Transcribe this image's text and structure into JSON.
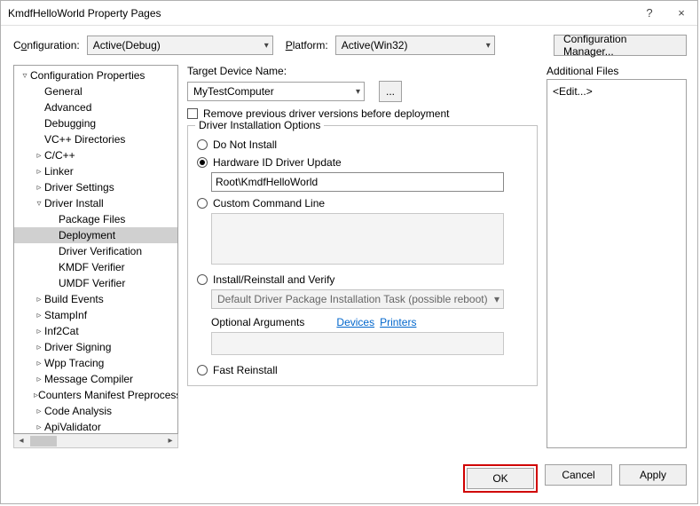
{
  "window": {
    "title": "KmdfHelloWorld Property Pages",
    "help": "?",
    "close": "×"
  },
  "top": {
    "config_label_pre": "C",
    "config_label_u": "o",
    "config_label_post": "nfiguration:",
    "config_value": "Active(Debug)",
    "platform_label_pre": "",
    "platform_label_u": "P",
    "platform_label_post": "latform:",
    "platform_value": "Active(Win32)",
    "config_mgr": "Configuration Manager..."
  },
  "tree": [
    {
      "d": 0,
      "t": "▿",
      "l": "Configuration Properties"
    },
    {
      "d": 1,
      "t": "",
      "l": "General"
    },
    {
      "d": 1,
      "t": "",
      "l": "Advanced"
    },
    {
      "d": 1,
      "t": "",
      "l": "Debugging"
    },
    {
      "d": 1,
      "t": "",
      "l": "VC++ Directories"
    },
    {
      "d": 1,
      "t": "▹",
      "l": "C/C++"
    },
    {
      "d": 1,
      "t": "▹",
      "l": "Linker"
    },
    {
      "d": 1,
      "t": "▹",
      "l": "Driver Settings"
    },
    {
      "d": 1,
      "t": "▿",
      "l": "Driver Install"
    },
    {
      "d": 2,
      "t": "",
      "l": "Package Files"
    },
    {
      "d": 2,
      "t": "",
      "l": "Deployment",
      "sel": true
    },
    {
      "d": 2,
      "t": "",
      "l": "Driver Verification"
    },
    {
      "d": 2,
      "t": "",
      "l": "KMDF Verifier"
    },
    {
      "d": 2,
      "t": "",
      "l": "UMDF Verifier"
    },
    {
      "d": 1,
      "t": "▹",
      "l": "Build Events"
    },
    {
      "d": 1,
      "t": "▹",
      "l": "StampInf"
    },
    {
      "d": 1,
      "t": "▹",
      "l": "Inf2Cat"
    },
    {
      "d": 1,
      "t": "▹",
      "l": "Driver Signing"
    },
    {
      "d": 1,
      "t": "▹",
      "l": "Wpp Tracing"
    },
    {
      "d": 1,
      "t": "▹",
      "l": "Message Compiler"
    },
    {
      "d": 1,
      "t": "▹",
      "l": "Counters Manifest Preprocessor"
    },
    {
      "d": 1,
      "t": "▹",
      "l": "Code Analysis"
    },
    {
      "d": 1,
      "t": "▹",
      "l": "ApiValidator"
    }
  ],
  "form": {
    "target_label": "Target Device Name:",
    "target_value": "MyTestComputer",
    "browse": "...",
    "remove_label": "Remove previous driver versions before deployment",
    "group": "Driver Installation Options",
    "r_do_not": "Do Not Install",
    "r_hwid": "Hardware ID Driver Update",
    "hwid_value": "Root\\KmdfHelloWorld",
    "r_custom": "Custom Command Line",
    "r_install": "Install/Reinstall and Verify",
    "install_combo": "Default Driver Package Installation Task (possible reboot)",
    "opt_args": "Optional Arguments",
    "link_devices": "Devices",
    "link_printers": "Printers",
    "r_fast": "Fast Reinstall"
  },
  "side": {
    "label": "Additional Files",
    "edit": "<Edit...>"
  },
  "footer": {
    "ok": "OK",
    "cancel": "Cancel",
    "apply": "Apply"
  }
}
